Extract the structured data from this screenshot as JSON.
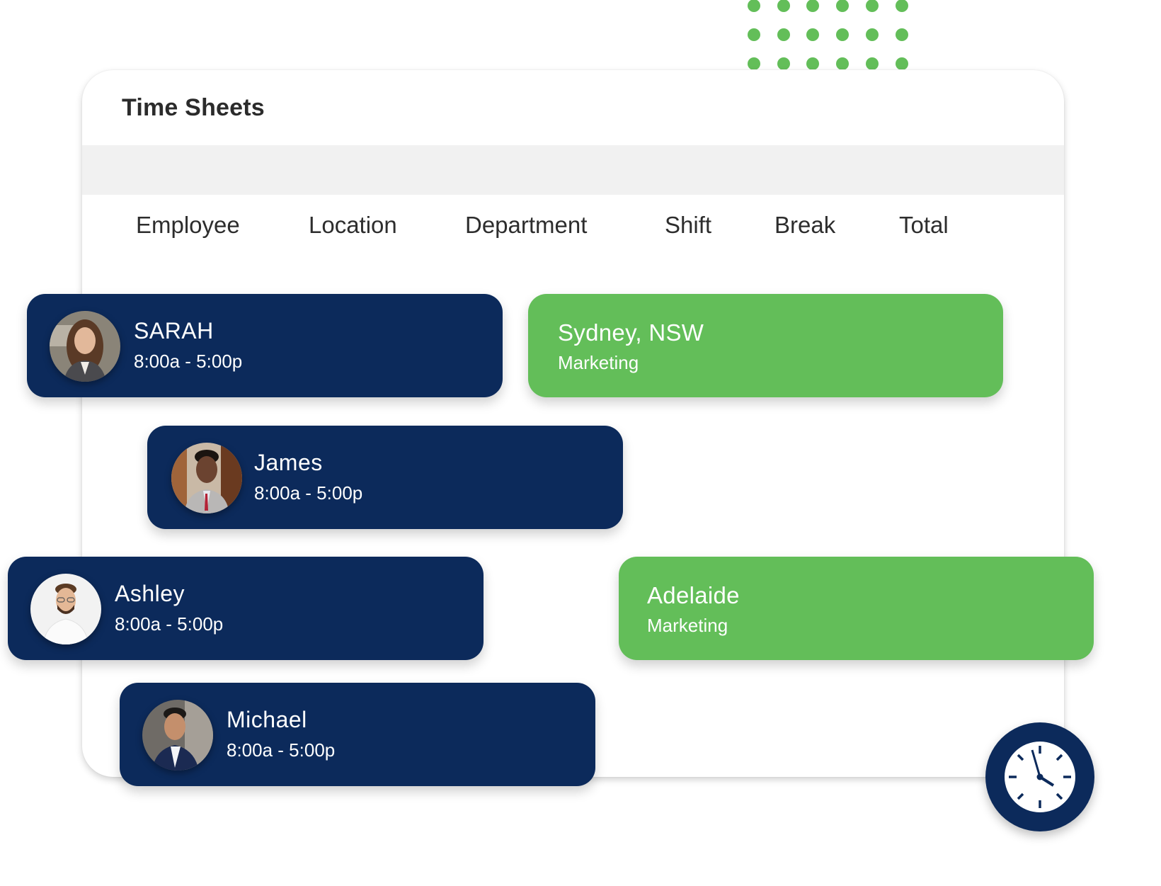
{
  "colors": {
    "navy": "#0c2a5b",
    "green": "#63be59",
    "band": "#f1f1f1",
    "title_text": "#2b2b2b"
  },
  "panel": {
    "title": "Time Sheets",
    "columns": [
      "Employee",
      "Location",
      "Department",
      "Shift",
      "Break",
      "Total"
    ]
  },
  "employees": [
    {
      "name": "SARAH",
      "shift": "8:00a - 5:00p",
      "avatar": "avatar-photo-woman"
    },
    {
      "name": "James",
      "shift": "8:00a - 5:00p",
      "avatar": "avatar-photo-man"
    },
    {
      "name": "Ashley",
      "shift": "8:00a - 5:00p",
      "avatar": "avatar-photo-man-glasses"
    },
    {
      "name": "Michael",
      "shift": "8:00a - 5:00p",
      "avatar": "avatar-photo-man-suit"
    }
  ],
  "locations": [
    {
      "name": "Sydney, NSW",
      "department": "Marketing"
    },
    {
      "name": "Adelaide",
      "department": "Marketing"
    }
  ],
  "decor": {
    "dot_grid": "green-dot-pattern",
    "clock": "clock-icon"
  }
}
